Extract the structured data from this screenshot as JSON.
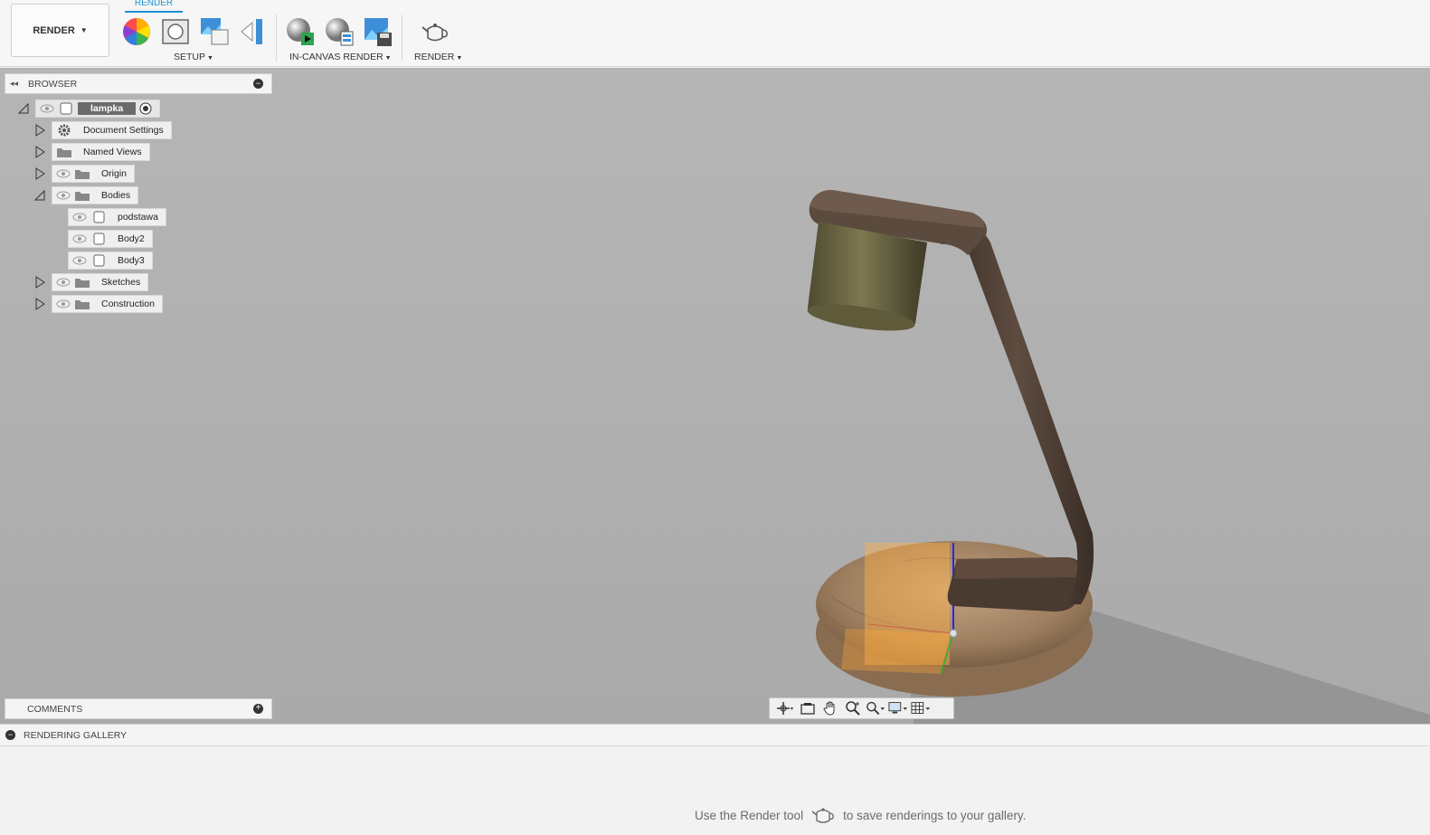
{
  "toolbar": {
    "workspace_label": "RENDER",
    "active_tab": "RENDER",
    "groups": {
      "setup": "SETUP",
      "in_canvas": "IN-CANVAS RENDER",
      "render": "RENDER"
    },
    "icons": [
      "appearance-icon",
      "scene-settings-icon",
      "texture-map-icon",
      "decal-icon",
      "in-canvas-render-icon",
      "in-canvas-settings-icon",
      "capture-image-icon",
      "render-teapot-icon"
    ]
  },
  "browser": {
    "title": "BROWSER",
    "root": "lampka",
    "items": [
      {
        "label": "Document Settings",
        "icon": "gear-icon"
      },
      {
        "label": "Named Views",
        "icon": "folder-icon"
      },
      {
        "label": "Origin",
        "icon": "folder-icon"
      },
      {
        "label": "Bodies",
        "icon": "folder-icon"
      },
      {
        "label": "podstawa",
        "icon": "body-icon"
      },
      {
        "label": "Body2",
        "icon": "body-icon"
      },
      {
        "label": "Body3",
        "icon": "body-icon"
      },
      {
        "label": "Sketches",
        "icon": "folder-icon"
      },
      {
        "label": "Construction",
        "icon": "folder-icon"
      }
    ]
  },
  "comments": {
    "title": "COMMENTS"
  },
  "gallery": {
    "title": "RENDERING GALLERY",
    "hint_before": "Use the Render tool",
    "hint_after": "to save renderings to your gallery."
  },
  "colors": {
    "accent": "#1b8fd6",
    "viewport_bg": "#b0b0b0",
    "lamp_metal": "#5a4a3e",
    "shade": "#6e6a44",
    "wood_base": "#b09070"
  }
}
